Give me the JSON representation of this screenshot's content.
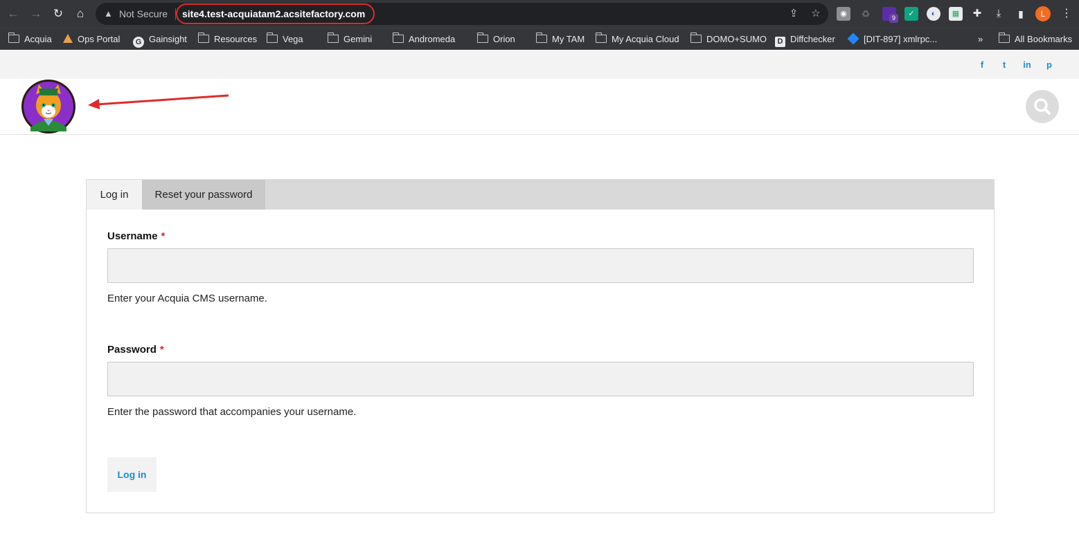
{
  "browser": {
    "security_label": "Not Secure",
    "url": "site4.test-acquiatam2.acsitefactory.com",
    "extension_badge": "9",
    "profile_initial": "L",
    "bookmarks": [
      {
        "label": "Acquia",
        "icon": "folder-icon"
      },
      {
        "label": "Ops Portal",
        "icon": "ops-portal-icon"
      },
      {
        "label": "Gainsight",
        "icon": "gainsight-icon"
      },
      {
        "label": "Resources",
        "icon": "folder-icon"
      },
      {
        "label": "Vega",
        "icon": "folder-icon"
      },
      {
        "label": "Gemini",
        "icon": "folder-icon"
      },
      {
        "label": "Andromeda",
        "icon": "folder-icon"
      },
      {
        "label": "Orion",
        "icon": "folder-icon"
      },
      {
        "label": "My TAM",
        "icon": "folder-icon"
      },
      {
        "label": "My Acquia Cloud",
        "icon": "folder-icon"
      },
      {
        "label": "DOMO+SUMO",
        "icon": "folder-icon"
      },
      {
        "label": "Diffchecker",
        "icon": "diffchecker-icon"
      },
      {
        "label": "[DIT-897] xmlrpc...",
        "icon": "jira-icon"
      }
    ],
    "more_bookmarks": "»",
    "all_bookmarks": "All Bookmarks"
  },
  "site": {
    "social": [
      "f",
      "t",
      "in",
      "p"
    ],
    "tabs": [
      "Log in",
      "Reset your password"
    ],
    "username_label": "Username",
    "username_help": "Enter your Acquia CMS username.",
    "password_label": "Password",
    "password_help": "Enter the password that accompanies your username.",
    "required_mark": "*",
    "submit_label": "Log in"
  },
  "colors": {
    "accent": "#1b8fd0",
    "required": "#d9243b",
    "annotation": "#e02a2a"
  }
}
